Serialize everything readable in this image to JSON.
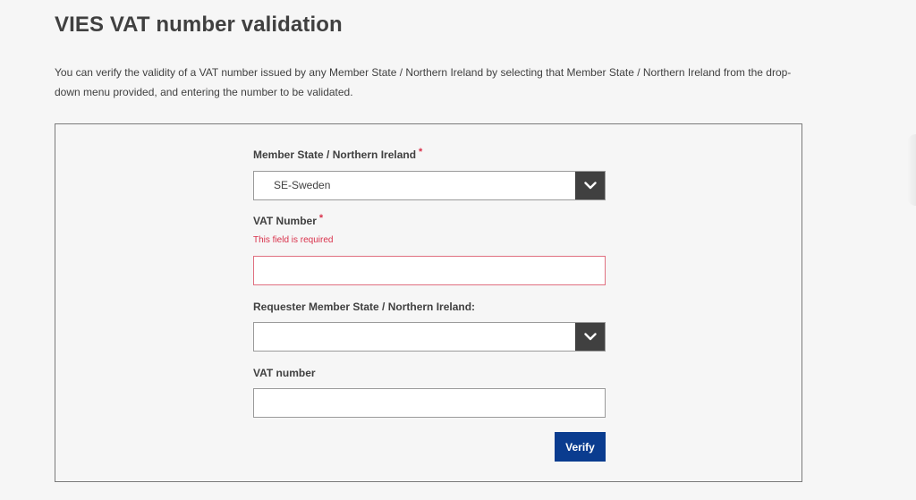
{
  "page": {
    "title": "VIES VAT number validation",
    "intro": "You can verify the validity of a VAT number issued by any Member State / Northern Ireland by selecting that Member State / Northern Ireland from the drop-down menu provided, and entering the number to be validated."
  },
  "form": {
    "member_state": {
      "label": "Member State / Northern Ireland",
      "required_mark": "*",
      "selected_value": "SE-Sweden",
      "icon": "chevron-down-icon"
    },
    "vat_number": {
      "label": "VAT Number",
      "required_mark": "*",
      "error": "This field is required",
      "value": ""
    },
    "requester_member_state": {
      "label": "Requester Member State / Northern Ireland:",
      "selected_value": "",
      "icon": "chevron-down-icon"
    },
    "requester_vat_number": {
      "label": "VAT number",
      "value": ""
    },
    "verify_label": "Verify"
  },
  "colors": {
    "accent": "#0a3c8f",
    "error": "#d9304a",
    "dropdown_toggle": "#404040",
    "background": "#f6f6f6"
  }
}
